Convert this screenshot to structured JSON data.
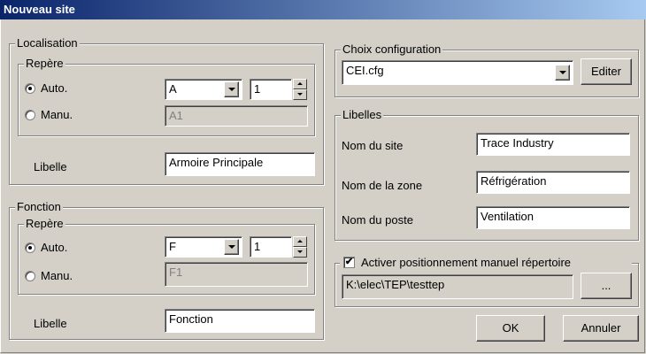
{
  "window": {
    "title": "Nouveau site"
  },
  "localisation": {
    "legend": "Localisation",
    "repere": {
      "legend": "Repère",
      "auto_label": "Auto.",
      "manu_label": "Manu.",
      "auto_value": "A",
      "auto_number": "1",
      "manu_value": "A1",
      "selected": "auto"
    },
    "libelle_label": "Libelle",
    "libelle_value": "Armoire Principale"
  },
  "fonction": {
    "legend": "Fonction",
    "repere": {
      "legend": "Repère",
      "auto_label": "Auto.",
      "manu_label": "Manu.",
      "auto_value": "F",
      "auto_number": "1",
      "manu_value": "F1",
      "selected": "auto"
    },
    "libelle_label": "Libelle",
    "libelle_value": "Fonction"
  },
  "choix_configuration": {
    "legend": "Choix configuration",
    "value": "CEI.cfg",
    "edit_label": "Editer"
  },
  "libelles": {
    "legend": "Libelles",
    "rows": [
      {
        "label": "Nom du site",
        "value": "Trace Industry"
      },
      {
        "label": "Nom de la zone",
        "value": "Réfrigération"
      },
      {
        "label": "Nom du poste",
        "value": "Ventilation"
      }
    ]
  },
  "repertoire": {
    "checkbox_label": "Activer positionnement manuel répertoire",
    "checked": true,
    "check_glyph": "✔",
    "path": "K:\\elec\\TEP\\testtep",
    "browse_label": "..."
  },
  "buttons": {
    "ok": "OK",
    "cancel": "Annuler"
  }
}
